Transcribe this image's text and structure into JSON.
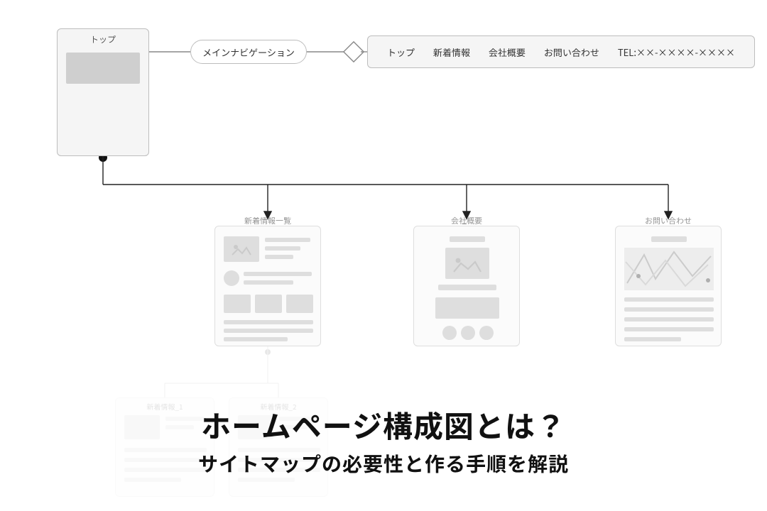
{
  "diagram": {
    "top_card": {
      "title": "トップ"
    },
    "main_nav_pill": "メインナビゲーション",
    "navbar": {
      "items": [
        "トップ",
        "新着情報",
        "会社概要",
        "お問い合わせ",
        "TEL:××-××××-××××"
      ]
    },
    "children": {
      "news": {
        "title": "新着情報一覧"
      },
      "company": {
        "title": "会社概要"
      },
      "contact": {
        "title": "お問い合わせ"
      }
    },
    "faded_children": {
      "c1": {
        "title": "新着情報_1"
      },
      "c2": {
        "title": "新着情報_2"
      }
    }
  },
  "headline": {
    "title": "ホームページ構成図とは？",
    "subtitle": "サイトマップの必要性と作る手順を解説"
  }
}
